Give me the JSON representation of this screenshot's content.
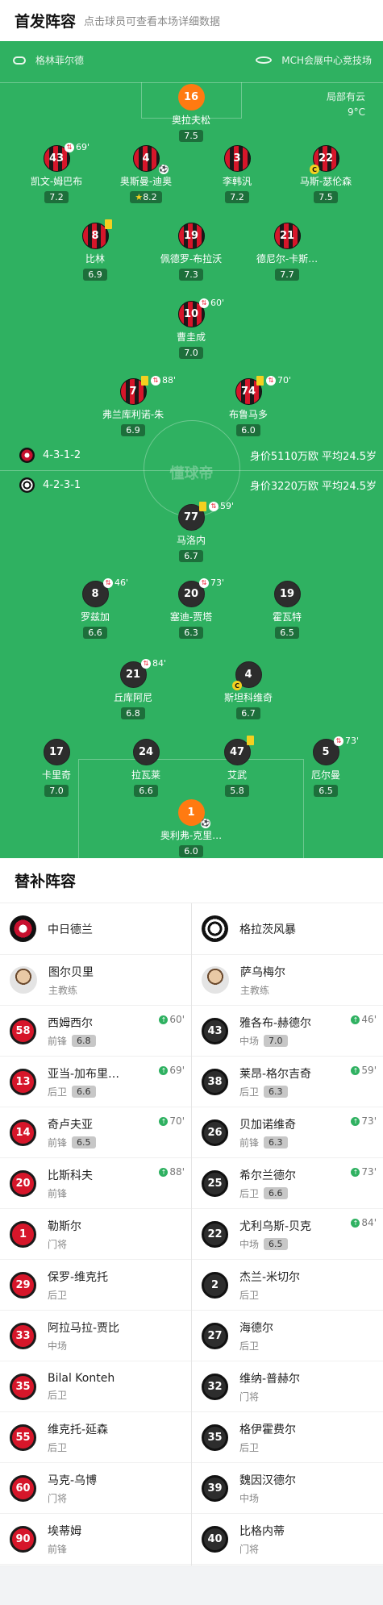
{
  "header": {
    "title": "首发阵容",
    "subtitle": "点击球员可查看本场详细数据"
  },
  "pitch": {
    "home_team": "格林菲尔德",
    "venue": "MCH会展中心竞技场",
    "weather": {
      "condition": "局部有云",
      "temp": "9°C"
    },
    "watermark": "懂球帝",
    "home_formation": {
      "formation": "4-3-1-2",
      "value": "身价5110万欧 平均24.5岁"
    },
    "away_formation": {
      "formation": "4-2-3-1",
      "value": "身价3220万欧 平均24.5岁"
    },
    "home_players": [
      {
        "num": "16",
        "name": "奥拉夫松",
        "rating": "7.5"
      },
      {
        "num": "43",
        "name": "凯文-姆巴布",
        "rating": "7.2",
        "sub_time": "69'"
      },
      {
        "num": "4",
        "name": "奥斯曼-迪奥",
        "rating": "8.2"
      },
      {
        "num": "3",
        "name": "李韩汎",
        "rating": "7.2"
      },
      {
        "num": "22",
        "name": "马斯-瑟伦森",
        "rating": "7.5"
      },
      {
        "num": "8",
        "name": "比林",
        "rating": "6.9"
      },
      {
        "num": "19",
        "name": "佩德罗-布拉沃",
        "rating": "7.3"
      },
      {
        "num": "21",
        "name": "德尼尔-卡斯…",
        "rating": "7.7"
      },
      {
        "num": "10",
        "name": "曹圭成",
        "rating": "7.0",
        "sub_time": "60'"
      },
      {
        "num": "7",
        "name": "弗兰库利诺-朱",
        "rating": "6.9",
        "sub_time": "88'"
      },
      {
        "num": "74",
        "name": "布鲁马多",
        "rating": "6.0",
        "sub_time": "70'"
      }
    ],
    "away_players": [
      {
        "num": "77",
        "name": "马洛内",
        "rating": "6.7",
        "sub_time": "59'"
      },
      {
        "num": "8",
        "name": "罗兹加",
        "rating": "6.6",
        "sub_time": "46'"
      },
      {
        "num": "20",
        "name": "塞迪-贾塔",
        "rating": "6.3",
        "sub_time": "73'"
      },
      {
        "num": "19",
        "name": "霍瓦特",
        "rating": "6.5"
      },
      {
        "num": "21",
        "name": "丘库阿尼",
        "rating": "6.8",
        "sub_time": "84'"
      },
      {
        "num": "4",
        "name": "斯坦科维奇",
        "rating": "6.7"
      },
      {
        "num": "17",
        "name": "卡里奇",
        "rating": "7.0"
      },
      {
        "num": "24",
        "name": "拉瓦莱",
        "rating": "6.6"
      },
      {
        "num": "47",
        "name": "艾武",
        "rating": "5.8"
      },
      {
        "num": "5",
        "name": "厄尔曼",
        "rating": "6.5",
        "sub_time": "73'"
      },
      {
        "num": "1",
        "name": "奥利弗-克里…",
        "rating": "6.0"
      }
    ]
  },
  "subs": {
    "title": "替补阵容",
    "home": {
      "team": "中日德兰",
      "coach": {
        "name": "图尔贝里",
        "role": "主教练"
      },
      "players": [
        {
          "num": "58",
          "name": "西姆西尔",
          "pos": "前锋",
          "rating": "6.8",
          "time": "60'"
        },
        {
          "num": "13",
          "name": "亚当-加布里…",
          "pos": "后卫",
          "rating": "6.6",
          "time": "69'"
        },
        {
          "num": "14",
          "name": "奇卢夫亚",
          "pos": "前锋",
          "rating": "6.5",
          "time": "70'"
        },
        {
          "num": "20",
          "name": "比斯科夫",
          "pos": "前锋",
          "time": "88'"
        },
        {
          "num": "1",
          "name": "勒斯尔",
          "pos": "门将"
        },
        {
          "num": "29",
          "name": "保罗-维克托",
          "pos": "后卫"
        },
        {
          "num": "33",
          "name": "阿拉马拉-贾比",
          "pos": "中场"
        },
        {
          "num": "35",
          "name": "Bilal Konteh",
          "pos": "后卫"
        },
        {
          "num": "55",
          "name": "维克托-延森",
          "pos": "后卫"
        },
        {
          "num": "60",
          "name": "马克-乌博",
          "pos": "门将"
        },
        {
          "num": "90",
          "name": "埃蒂姆",
          "pos": "前锋"
        }
      ]
    },
    "away": {
      "team": "格拉茨风暴",
      "coach": {
        "name": "萨乌梅尔",
        "role": "主教练"
      },
      "players": [
        {
          "num": "43",
          "name": "雅各布-赫德尔",
          "pos": "中场",
          "rating": "7.0",
          "time": "46'"
        },
        {
          "num": "38",
          "name": "莱昂-格尔吉奇",
          "pos": "后卫",
          "rating": "6.3",
          "time": "59'"
        },
        {
          "num": "26",
          "name": "贝加诺维奇",
          "pos": "前锋",
          "rating": "6.3",
          "time": "73'"
        },
        {
          "num": "25",
          "name": "希尔兰德尔",
          "pos": "后卫",
          "rating": "6.6",
          "time": "73'"
        },
        {
          "num": "22",
          "name": "尤利乌斯-贝克",
          "pos": "中场",
          "rating": "6.5",
          "time": "84'"
        },
        {
          "num": "2",
          "name": "杰兰-米切尔",
          "pos": "后卫"
        },
        {
          "num": "27",
          "name": "海德尔",
          "pos": "后卫"
        },
        {
          "num": "32",
          "name": "维纳-普赫尔",
          "pos": "门将"
        },
        {
          "num": "35",
          "name": "格伊霍费尔",
          "pos": "后卫"
        },
        {
          "num": "39",
          "name": "魏因汉德尔",
          "pos": "中场"
        },
        {
          "num": "40",
          "name": "比格内蒂",
          "pos": "门将"
        }
      ]
    }
  }
}
